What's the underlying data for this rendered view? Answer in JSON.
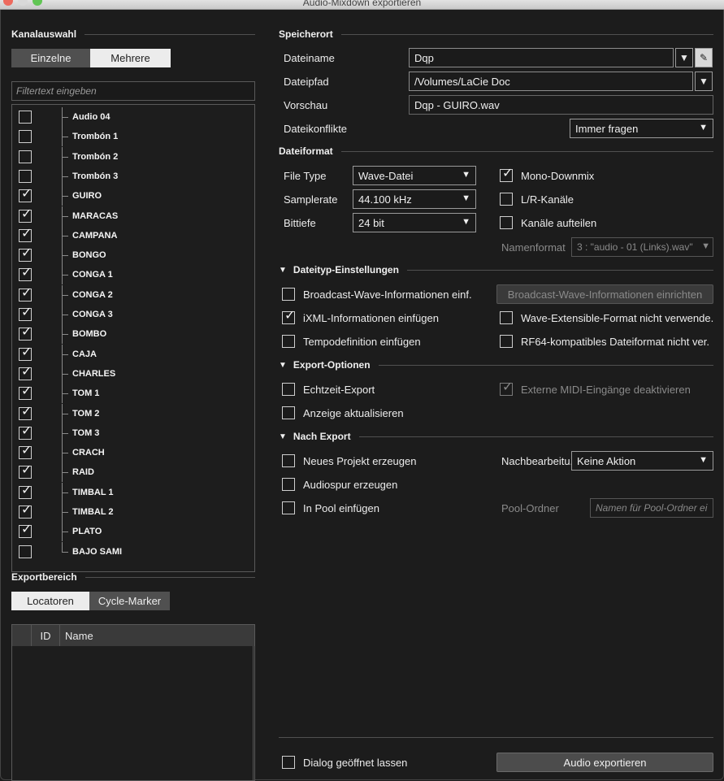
{
  "window": {
    "title": "Audio-Mixdown exportieren"
  },
  "channel_selection": {
    "header": "Kanalauswahl",
    "tabs": [
      "Einzelne",
      "Mehrere"
    ],
    "filter_placeholder": "Filtertext eingeben",
    "channels": [
      {
        "name": "Audio 04",
        "checked": false
      },
      {
        "name": "Trombón 1",
        "checked": false
      },
      {
        "name": "Trombón 2",
        "checked": false
      },
      {
        "name": "Trombón 3",
        "checked": false
      },
      {
        "name": "GUIRO",
        "checked": true
      },
      {
        "name": "MARACAS",
        "checked": true
      },
      {
        "name": "CAMPANA",
        "checked": true
      },
      {
        "name": "BONGO",
        "checked": true
      },
      {
        "name": "CONGA 1",
        "checked": true
      },
      {
        "name": "CONGA 2",
        "checked": true
      },
      {
        "name": "CONGA 3",
        "checked": true
      },
      {
        "name": "BOMBO",
        "checked": true
      },
      {
        "name": "CAJA",
        "checked": true
      },
      {
        "name": "CHARLES",
        "checked": true
      },
      {
        "name": "TOM 1",
        "checked": true
      },
      {
        "name": "TOM 2",
        "checked": true
      },
      {
        "name": "TOM 3",
        "checked": true
      },
      {
        "name": "CRACH",
        "checked": true
      },
      {
        "name": "RAID",
        "checked": true
      },
      {
        "name": "TIMBAL 1",
        "checked": true
      },
      {
        "name": "TIMBAL 2",
        "checked": true
      },
      {
        "name": "PLATO",
        "checked": true
      },
      {
        "name": "BAJO SAMI",
        "checked": false
      }
    ]
  },
  "export_range": {
    "header": "Exportbereich",
    "tabs": [
      "Locatoren",
      "Cycle-Marker"
    ],
    "columns": [
      "",
      "ID",
      "Name"
    ]
  },
  "location": {
    "header": "Speicherort",
    "filename_label": "Dateiname",
    "filename_value": "Dqp",
    "path_label": "Dateipfad",
    "path_value": "/Volumes/LaCie Doc",
    "preview_label": "Vorschau",
    "preview_value": "Dqp - GUIRO.wav",
    "conflicts_label": "Dateikonflikte",
    "conflicts_value": "Immer fragen"
  },
  "file_format": {
    "header": "Dateiformat",
    "filetype_label": "File Type",
    "filetype_value": "Wave-Datei",
    "samplerate_label": "Samplerate",
    "samplerate_value": "44.100 kHz",
    "bitdepth_label": "Bittiefe",
    "bitdepth_value": "24 bit",
    "mono_downmix": {
      "label": "Mono-Downmix",
      "checked": true
    },
    "lr_channels": {
      "label": "L/R-Kanäle",
      "checked": false
    },
    "split_channels": {
      "label": "Kanäle aufteilen",
      "checked": false
    },
    "name_format_label": "Namenformat",
    "name_format_value": "3 : \"audio - 01 (Links).wav\""
  },
  "filetype_settings": {
    "header": "Dateityp-Einstellungen",
    "bwf_info": {
      "label": "Broadcast-Wave-Informationen einf.",
      "checked": false
    },
    "bwf_button": "Broadcast-Wave-Informationen einrichten",
    "ixml": {
      "label": "iXML-Informationen einfügen",
      "checked": true
    },
    "wave_ext": {
      "label": "Wave-Extensible-Format nicht verwende.",
      "checked": false
    },
    "tempo": {
      "label": "Tempodefinition einfügen",
      "checked": false
    },
    "rf64": {
      "label": "RF64-kompatibles Dateiformat nicht ver.",
      "checked": false
    }
  },
  "export_options": {
    "header": "Export-Optionen",
    "realtime": {
      "label": "Echtzeit-Export",
      "checked": false
    },
    "ext_midi": {
      "label": "Externe MIDI-Eingänge deaktivieren",
      "checked": true
    },
    "update_display": {
      "label": "Anzeige aktualisieren",
      "checked": false
    }
  },
  "after_export": {
    "header": "Nach Export",
    "new_project": {
      "label": "Neues Projekt erzeugen",
      "checked": false
    },
    "post_label": "Nachbearbeitu.",
    "post_value": "Keine Aktion",
    "audio_track": {
      "label": "Audiospur erzeugen",
      "checked": false
    },
    "pool": {
      "label": "In Pool einfügen",
      "checked": false
    },
    "pool_folder_label": "Pool-Ordner",
    "pool_folder_placeholder": "Namen für Pool-Ordner ei"
  },
  "footer": {
    "keep_open": {
      "label": "Dialog geöffnet lassen",
      "checked": false
    },
    "export_button": "Audio exportieren"
  },
  "icons": {
    "tick": "✓",
    "dropdown": "▼",
    "pencil": "✎",
    "collapse": "▼"
  }
}
